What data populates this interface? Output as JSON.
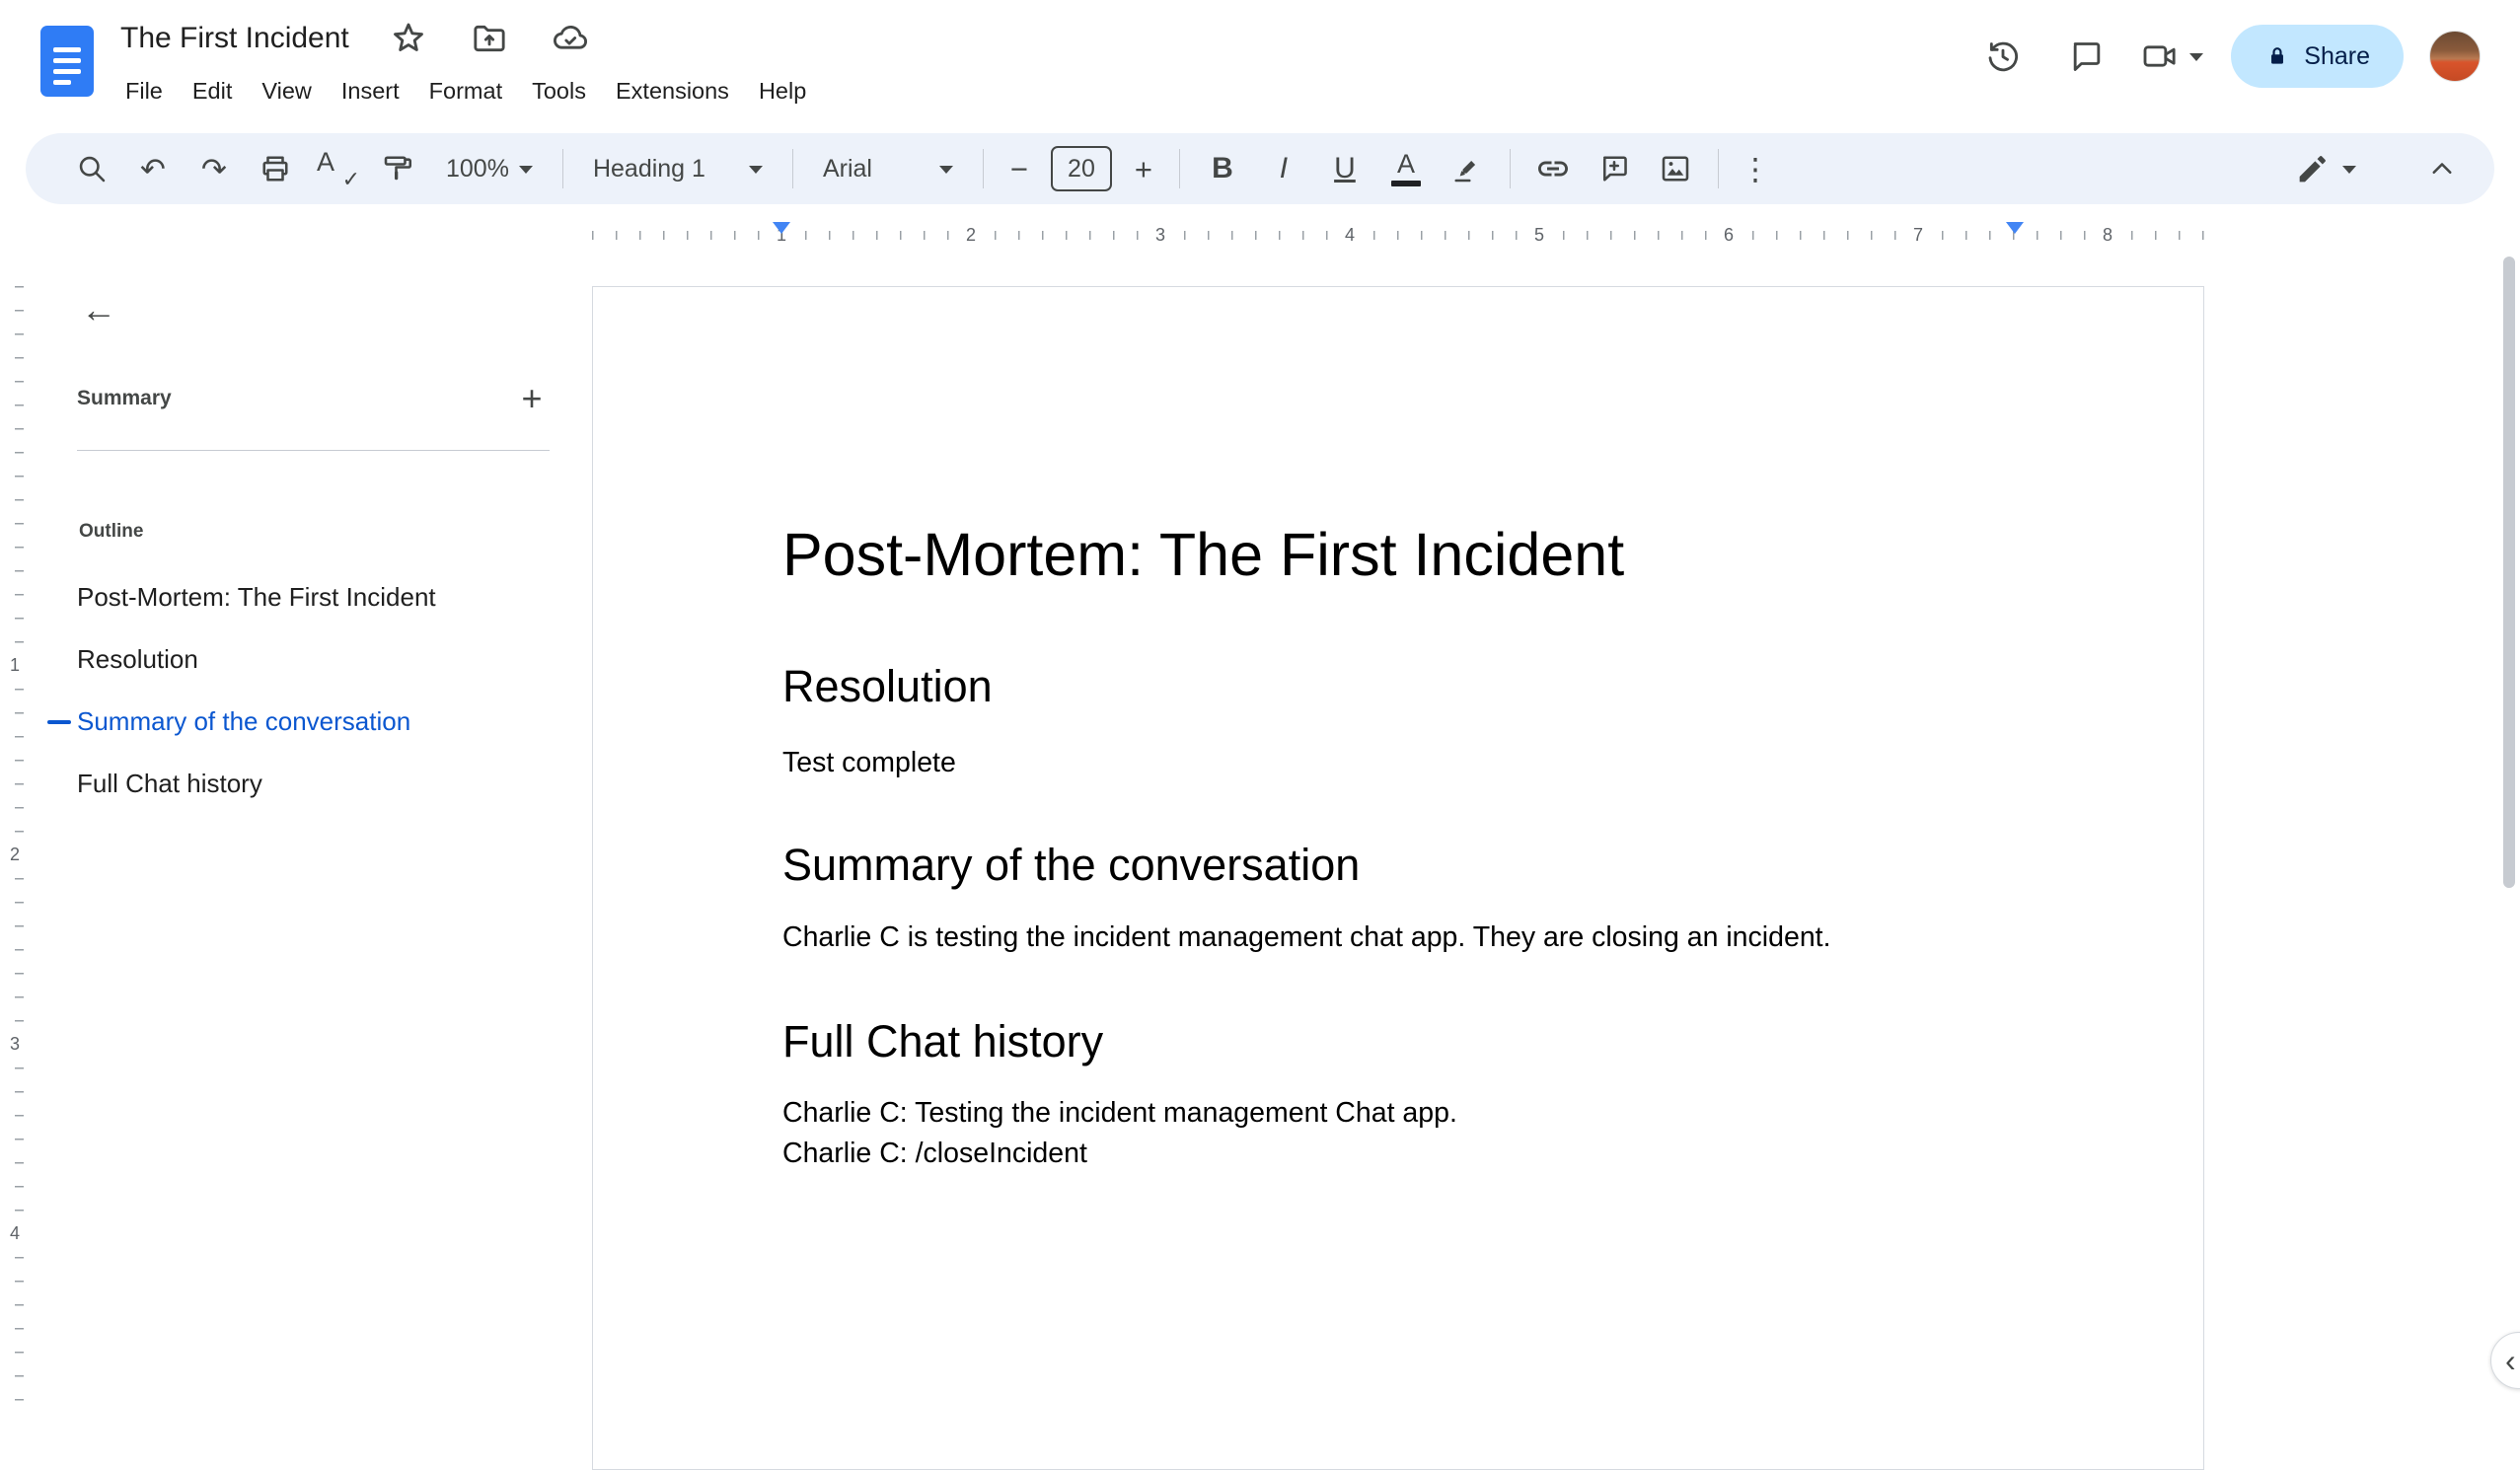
{
  "colors": {
    "accent_blue": "#0b57d0",
    "toolbar_bg": "#edf2fa",
    "share_bg": "#c2e7ff",
    "share_text": "#041e49",
    "icon_grey": "#444746",
    "ruler_marker_blue": "#4285f4",
    "logo_blue": "#2f7cf5"
  },
  "header": {
    "doc_title": "The First Incident",
    "menu_items": [
      "File",
      "Edit",
      "View",
      "Insert",
      "Format",
      "Tools",
      "Extensions",
      "Help"
    ],
    "share_label": "Share"
  },
  "toolbar": {
    "undo_glyph": "↶",
    "redo_glyph": "↷",
    "zoom_value": "100%",
    "paragraph_style": "Heading 1",
    "font_family": "Arial",
    "minus_glyph": "−",
    "font_size": "20",
    "plus_glyph": "+",
    "bold_glyph": "B",
    "italic_glyph": "I",
    "underline_glyph": "U",
    "text_color_glyph": "A",
    "spell_a": "A",
    "spell_check": "✓",
    "more_glyph": "⋮"
  },
  "ruler": {
    "h_numbers": [
      "1",
      "2",
      "3",
      "4",
      "5",
      "6",
      "7",
      "8"
    ],
    "v_numbers": [
      "1",
      "2",
      "3",
      "4"
    ]
  },
  "sidebar": {
    "back_glyph": "←",
    "summary_title": "Summary",
    "add_glyph": "+",
    "outline_title": "Outline",
    "outline_items": [
      "Post-Mortem: The First Incident",
      "Resolution",
      "Summary of the conversation",
      "Full Chat history"
    ],
    "active_index": 2
  },
  "document": {
    "title": "Post-Mortem: The First Incident",
    "sections": [
      {
        "heading": "Resolution",
        "body": [
          "Test complete"
        ]
      },
      {
        "heading": "Summary of the conversation",
        "body": [
          "Charlie C is testing the incident management chat app. They are closing an incident."
        ]
      },
      {
        "heading": "Full Chat history",
        "body": [
          "Charlie C: Testing the incident management Chat app.",
          "Charlie C: /closeIncident"
        ]
      }
    ]
  },
  "panel_toggle_glyph": "‹"
}
